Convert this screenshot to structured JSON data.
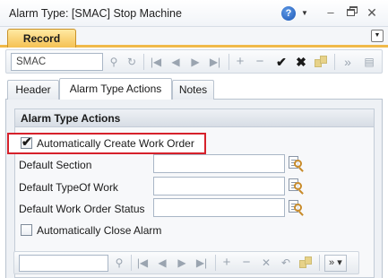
{
  "window": {
    "title": "Alarm Type: [SMAC] Stop Machine",
    "help_glyph": "?",
    "minimize_glyph": "‒",
    "close_glyph": "✕"
  },
  "tabstrip": {
    "record_tab_label": "Record"
  },
  "toolbar": {
    "search_value": "SMAC",
    "icons": [
      "search-icon",
      "refresh-icon",
      "first-record-icon",
      "previous-record-icon",
      "next-record-icon",
      "last-record-icon",
      "add-icon",
      "remove-icon",
      "save-icon",
      "cancel-icon",
      "attachments-icon",
      "more-icon",
      "collapse-icon"
    ]
  },
  "subtabs": [
    {
      "label": "Header",
      "active": false
    },
    {
      "label": "Alarm Type Actions",
      "active": true
    },
    {
      "label": "Notes",
      "active": false
    }
  ],
  "section": {
    "title": "Alarm Type Actions",
    "auto_work_order": {
      "label": "Automatically Create Work Order",
      "checked": true
    },
    "fields": [
      {
        "label": "Default Section",
        "value": ""
      },
      {
        "label": "Default TypeOf Work",
        "value": ""
      },
      {
        "label": "Default Work Order Status",
        "value": ""
      }
    ],
    "auto_close_alarm": {
      "label": "Automatically Close Alarm",
      "checked": false
    }
  },
  "bottom_toolbar": {
    "search_value": "",
    "more_label": "»",
    "more_arrow": "▾"
  },
  "colors": {
    "accent_orange": "#f0b94a",
    "highlight_red": "#d6212b",
    "help_blue": "#1c57b6"
  }
}
